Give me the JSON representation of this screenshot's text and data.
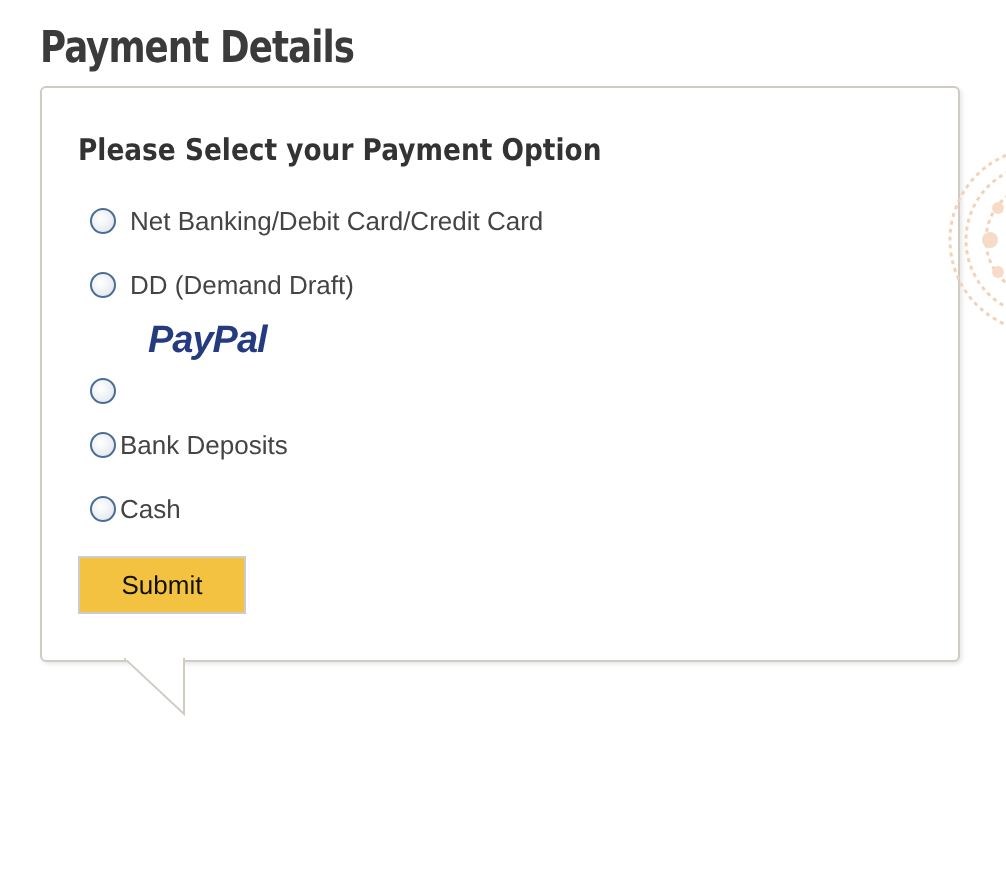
{
  "title": "Payment Details",
  "heading": "Please Select your Payment Option",
  "options": [
    {
      "kind": "text",
      "label": "Net Banking/Debit Card/Credit Card",
      "selected": false
    },
    {
      "kind": "text",
      "label": "DD (Demand Draft)",
      "selected": false
    },
    {
      "kind": "logo",
      "label": "PayPal",
      "selected": false
    },
    {
      "kind": "text",
      "label": "Bank Deposits",
      "selected": false
    },
    {
      "kind": "text",
      "label": "Cash",
      "selected": false
    }
  ],
  "submit": "Submit"
}
